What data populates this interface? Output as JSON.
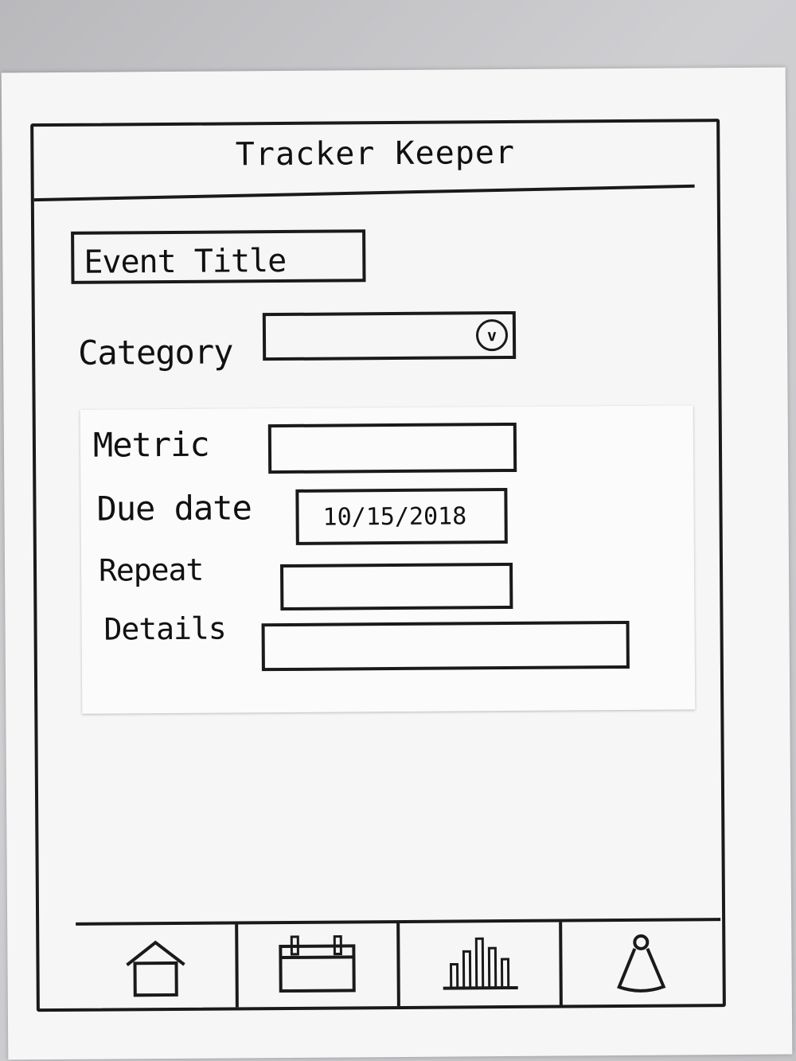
{
  "app": {
    "title": "Tracker Keeper"
  },
  "form": {
    "event_title_placeholder": "Event Title",
    "category_label": "Category",
    "category_value": "",
    "metric_label": "Metric",
    "metric_value": "",
    "due_date_label": "Due date",
    "due_date_value": "10/15/2018",
    "repeat_label": "Repeat",
    "repeat_value": "",
    "details_label": "Details",
    "details_value": ""
  },
  "tabbar": {
    "items": [
      {
        "icon": "home-icon"
      },
      {
        "icon": "calendar-icon"
      },
      {
        "icon": "chart-icon"
      },
      {
        "icon": "profile-icon"
      }
    ]
  },
  "colors": {
    "ink": "#1a1a1a",
    "paper": "#f6f6f7"
  }
}
